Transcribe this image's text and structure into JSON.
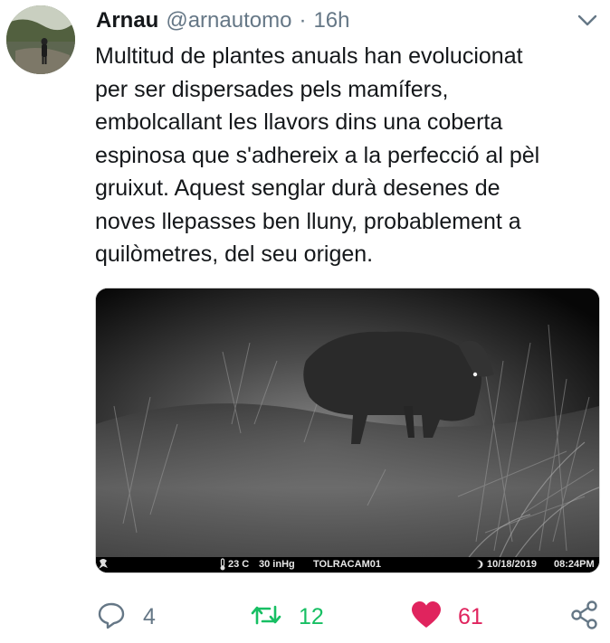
{
  "tweet": {
    "author_name": "Arnau",
    "author_handle": "@arnautomo",
    "separator": "·",
    "time": "16h",
    "text": "Multitud de plantes anuals han evolucionat\nper ser dispersades pels mamífers,\nembolcallant les llavors dins una coberta\nespinosa que s'adhereix a la perfecció al pèl\ngruixut. Aquest senglar durà desenes de\nnoves llepasses ben lluny, probablement a\nquilòmetres, del seu origen."
  },
  "media": {
    "temperature": "23 C",
    "pressure": "30 inHg",
    "camera_name": "TOLRACAM01",
    "date": "10/18/2019",
    "time": "08:24PM"
  },
  "actions": {
    "reply_count": "4",
    "retweet_count": "12",
    "like_count": "61"
  },
  "colors": {
    "text": "#14171a",
    "secondary": "#657786",
    "retweet": "#17bf63",
    "like": "#e0245e"
  },
  "icons": [
    "chevron-down-icon",
    "reply-icon",
    "retweet-icon",
    "heart-icon",
    "share-icon",
    "moon-icon",
    "thermometer-icon",
    "brand-logo-icon"
  ]
}
